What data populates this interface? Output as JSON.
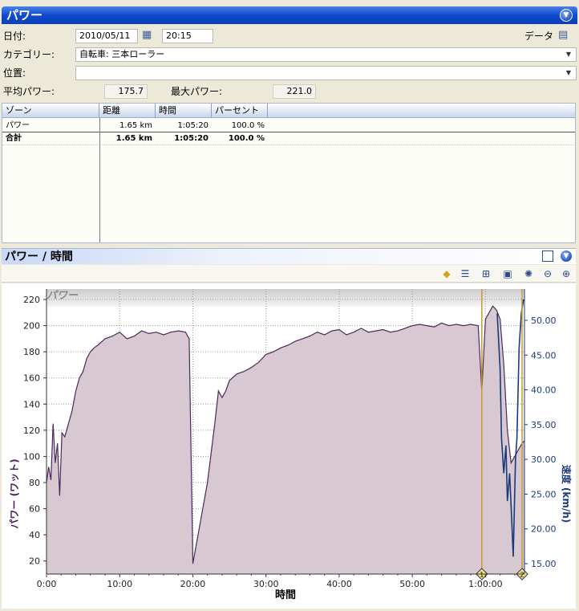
{
  "header": {
    "title": "パワー"
  },
  "form": {
    "date_label": "日付:",
    "date_value": "2010/05/11",
    "time_value": "20:15",
    "data_label": "データ",
    "category_label": "カテゴリー:",
    "category_value": "自転車: 三本ローラー",
    "location_label": "位置:",
    "location_value": "",
    "avg_power_label": "平均パワー:",
    "avg_power_value": "175.7",
    "max_power_label": "最大パワー:",
    "max_power_value": "221.0"
  },
  "table": {
    "columns": [
      "ゾーン",
      "距離",
      "時間",
      "パーセント"
    ],
    "rows": [
      {
        "zone": "パワー",
        "distance": "1.65 km",
        "time": "1:05:20",
        "percent": "100.0 %"
      }
    ],
    "total": {
      "zone": "合計",
      "distance": "1.65 km",
      "time": "1:05:20",
      "percent": "100.0 %"
    }
  },
  "chart_panel": {
    "title": "パワー / 時間",
    "toolbar_icons": [
      "diamond-icon",
      "list-icon",
      "chart-icon",
      "save-icon",
      "gear-icon",
      "zoom-out-icon",
      "zoom-in-icon"
    ]
  },
  "chart_data": {
    "type": "area",
    "series_label": "パワー",
    "xlabel": "時間",
    "ylabel_left": "パワー (ワット)",
    "ylabel_right": "速度 (km/h)",
    "x_ticks": [
      "0:00",
      "10:00",
      "20:00",
      "30:00",
      "40:00",
      "50:00",
      "1:00:00"
    ],
    "x_range_min": [
      0,
      65.33
    ],
    "y_ticks": [
      20,
      40,
      60,
      80,
      100,
      120,
      140,
      160,
      180,
      200,
      220
    ],
    "y_range": [
      10,
      228
    ],
    "y2_ticks": [
      "15.00",
      "20.00",
      "25.00",
      "30.00",
      "35.00",
      "40.00",
      "45.00",
      "50.00"
    ],
    "y2_range": [
      13.5,
      54.5
    ],
    "markers": [
      {
        "label": "1",
        "x_min": 59.5
      },
      {
        "label": "2",
        "x_min": 65.0
      }
    ],
    "colors": {
      "power_fill": "#d8c8d2",
      "power_line": "#4a2a5a",
      "speed_line": "#1a3a7a",
      "marker": "#c89a2a"
    },
    "power_points": [
      [
        0.0,
        80
      ],
      [
        0.3,
        92
      ],
      [
        0.6,
        82
      ],
      [
        0.9,
        125
      ],
      [
        1.2,
        95
      ],
      [
        1.5,
        110
      ],
      [
        1.8,
        70
      ],
      [
        2.1,
        118
      ],
      [
        2.5,
        115
      ],
      [
        3.0,
        125
      ],
      [
        3.5,
        135
      ],
      [
        4.0,
        150
      ],
      [
        4.5,
        160
      ],
      [
        5.0,
        165
      ],
      [
        5.5,
        175
      ],
      [
        6.0,
        180
      ],
      [
        6.5,
        183
      ],
      [
        7.0,
        185
      ],
      [
        8.0,
        190
      ],
      [
        9.0,
        192
      ],
      [
        10.0,
        195
      ],
      [
        11.0,
        190
      ],
      [
        12.0,
        192
      ],
      [
        13.0,
        196
      ],
      [
        14.0,
        194
      ],
      [
        15.0,
        195
      ],
      [
        16.0,
        193
      ],
      [
        17.0,
        195
      ],
      [
        18.0,
        196
      ],
      [
        19.0,
        195
      ],
      [
        19.5,
        190
      ],
      [
        20.0,
        18
      ],
      [
        22.0,
        80
      ],
      [
        23.0,
        125
      ],
      [
        23.5,
        150
      ],
      [
        24.0,
        145
      ],
      [
        24.5,
        150
      ],
      [
        25.0,
        158
      ],
      [
        26.0,
        163
      ],
      [
        27.0,
        165
      ],
      [
        28.0,
        168
      ],
      [
        29.0,
        172
      ],
      [
        30.0,
        178
      ],
      [
        31.0,
        180
      ],
      [
        32.0,
        183
      ],
      [
        33.0,
        185
      ],
      [
        34.0,
        188
      ],
      [
        35.0,
        190
      ],
      [
        36.0,
        192
      ],
      [
        37.0,
        195
      ],
      [
        38.0,
        193
      ],
      [
        39.0,
        196
      ],
      [
        40.0,
        197
      ],
      [
        41.0,
        193
      ],
      [
        42.0,
        195
      ],
      [
        43.0,
        198
      ],
      [
        44.0,
        195
      ],
      [
        45.0,
        196
      ],
      [
        46.0,
        197
      ],
      [
        47.0,
        195
      ],
      [
        48.0,
        196
      ],
      [
        49.0,
        198
      ],
      [
        50.0,
        200
      ],
      [
        51.0,
        201
      ],
      [
        52.0,
        200
      ],
      [
        53.0,
        199
      ],
      [
        54.0,
        202
      ],
      [
        55.0,
        200
      ],
      [
        56.0,
        201
      ],
      [
        57.0,
        200
      ],
      [
        58.0,
        201
      ],
      [
        59.0,
        200
      ],
      [
        59.5,
        150
      ],
      [
        60.0,
        205
      ],
      [
        60.5,
        210
      ],
      [
        61.0,
        215
      ],
      [
        61.5,
        212
      ],
      [
        62.0,
        205
      ],
      [
        62.5,
        170
      ],
      [
        63.0,
        120
      ],
      [
        63.5,
        95
      ],
      [
        64.0,
        100
      ],
      [
        64.5,
        105
      ],
      [
        65.0,
        110
      ],
      [
        65.33,
        112
      ]
    ],
    "speed_points": [
      [
        61.6,
        51
      ],
      [
        62.0,
        43
      ],
      [
        62.2,
        33
      ],
      [
        62.5,
        28
      ],
      [
        62.8,
        32
      ],
      [
        63.0,
        24
      ],
      [
        63.3,
        28
      ],
      [
        63.6,
        21
      ],
      [
        63.8,
        16
      ],
      [
        64.1,
        30
      ],
      [
        64.3,
        33
      ],
      [
        64.6,
        46
      ],
      [
        64.9,
        51
      ],
      [
        65.2,
        53
      ]
    ]
  }
}
